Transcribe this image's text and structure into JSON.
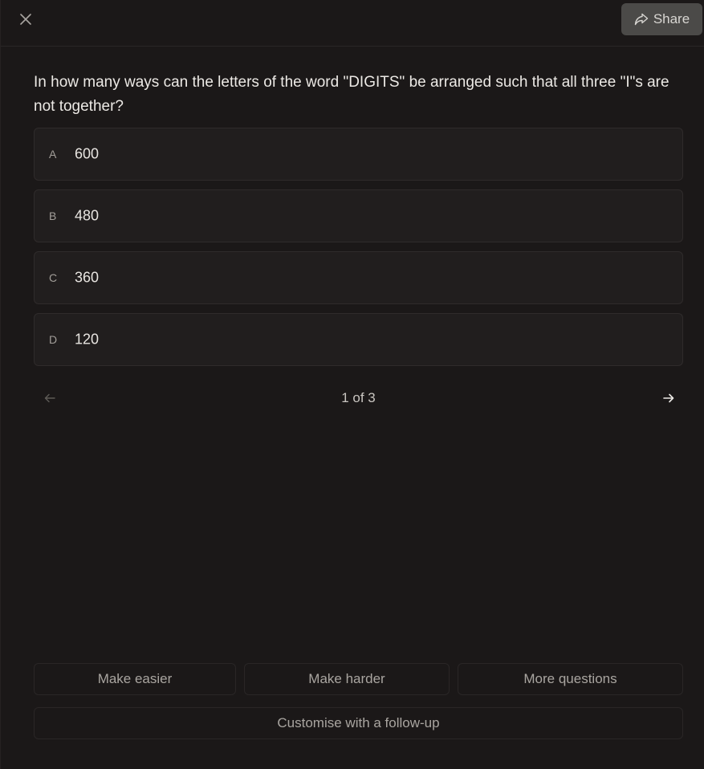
{
  "header": {
    "close_icon": "close-icon",
    "share_icon": "share-arrow-icon",
    "share_label": "Share"
  },
  "quiz": {
    "question": "In how many ways can the letters of the word \"DIGITS\" be arranged such that all three \"I\"s are not together?",
    "options": [
      {
        "letter": "A",
        "value": "600"
      },
      {
        "letter": "B",
        "value": "480"
      },
      {
        "letter": "C",
        "value": "360"
      },
      {
        "letter": "D",
        "value": "120"
      }
    ],
    "pager": {
      "label": "1 of 3",
      "prev_icon": "arrow-left-icon",
      "next_icon": "arrow-right-icon"
    }
  },
  "actions": {
    "easier_label": "Make easier",
    "harder_label": "Make harder",
    "more_label": "More questions",
    "customise_label": "Customise with a follow-up"
  },
  "colors": {
    "background": "#1b1818",
    "option_bg": "#211e1e",
    "share_bg": "#4b4a48"
  }
}
